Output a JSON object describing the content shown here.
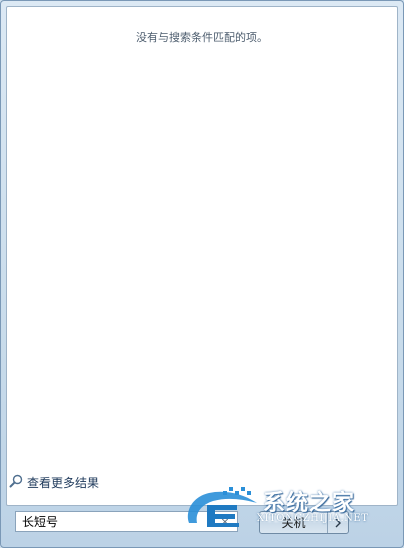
{
  "results": {
    "empty_message": "没有与搜索条件匹配的项。"
  },
  "see_more": {
    "label": "查看更多结果"
  },
  "search": {
    "value": "长短号",
    "clear_symbol": "×"
  },
  "power": {
    "shutdown_label": "关机"
  },
  "watermark": {
    "title": "系统之家",
    "url": "XITONGZHIJIA.NET"
  },
  "colors": {
    "frame": "#cfe0ee",
    "link_text": "#1e395b",
    "watermark_blue": "#2a8fd8"
  }
}
